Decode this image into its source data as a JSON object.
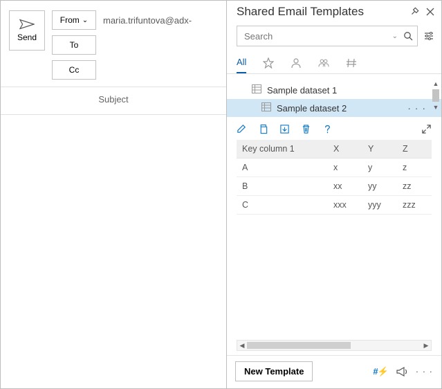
{
  "compose": {
    "send_label": "Send",
    "from_label": "From",
    "to_label": "To",
    "cc_label": "Cc",
    "from_value": "maria.trifuntova@adx-",
    "subject_label": "Subject"
  },
  "panel": {
    "title": "Shared Email Templates",
    "search_placeholder": "Search",
    "tabs": {
      "all": "All"
    },
    "datasets": [
      {
        "label": "Sample dataset 1",
        "selected": false
      },
      {
        "label": "Sample dataset 2",
        "selected": true
      }
    ],
    "grid": {
      "headers": [
        "Key column 1",
        "X",
        "Y",
        "Z"
      ],
      "rows": [
        [
          "A",
          "x",
          "y",
          "z"
        ],
        [
          "B",
          "xx",
          "yy",
          "zz"
        ],
        [
          "C",
          "xxx",
          "yyy",
          "zzz"
        ]
      ]
    },
    "new_template_label": "New Template",
    "hash_bolt": "#⚡"
  }
}
